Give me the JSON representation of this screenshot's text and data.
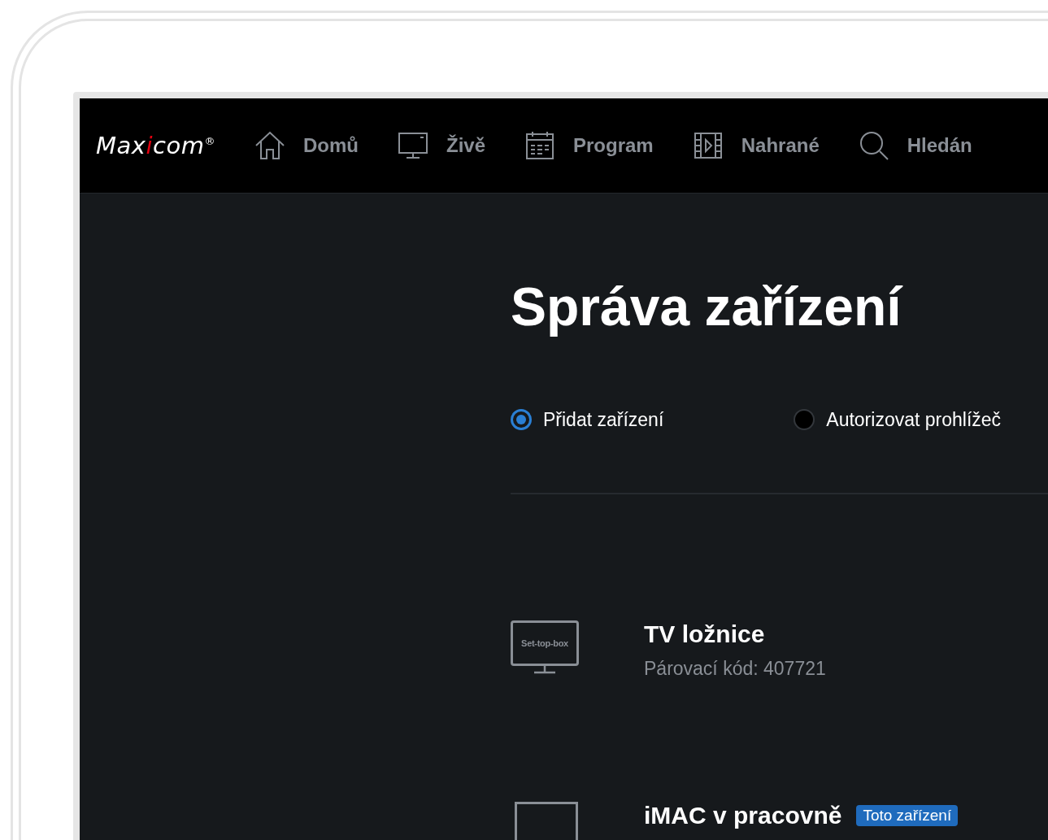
{
  "logo": {
    "before": "Max",
    "accent": "i",
    "after": "com",
    "mark": "®"
  },
  "nav": [
    {
      "kind": "home",
      "label": "Domů"
    },
    {
      "kind": "monitor",
      "label": "Živě"
    },
    {
      "kind": "calendar",
      "label": "Program"
    },
    {
      "kind": "film",
      "label": "Nahrané"
    },
    {
      "kind": "search",
      "label": "Hledán"
    }
  ],
  "title": "Správa zařízení",
  "options": [
    {
      "label": "Přidat zařízení",
      "selected": true
    },
    {
      "label": "Autorizovat prohlížeč",
      "selected": false
    }
  ],
  "devices": [
    {
      "kind": "set-top-box",
      "icon_label": "Set-top-box",
      "name": "TV ložnice",
      "detail": "Párovací kód: 407721"
    },
    {
      "kind": "computer",
      "name": "iMAC v pracovně",
      "badge": "Toto zařízení"
    }
  ]
}
